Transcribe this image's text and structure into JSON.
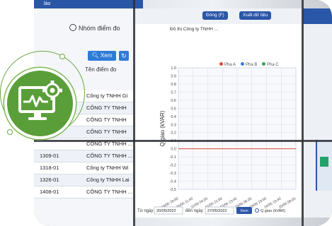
{
  "left_panel": {
    "window_title": "láo",
    "radio_label": "Nhóm điểm đo",
    "search_label": "Xem",
    "refresh_icon": "refresh-icon",
    "column_header": "Tên điểm đo",
    "rows": [
      {
        "code": "",
        "name": "Công ty TNHH Gi"
      },
      {
        "code": "",
        "name": "CÔNG TY TNHH"
      },
      {
        "code": "",
        "name": "CÔNG TY TNHH"
      },
      {
        "code": "",
        "name": "CÔNG TY TNHH"
      },
      {
        "code": "",
        "name": "CÔNG TY TNHH ..."
      },
      {
        "code": "1309-01",
        "name": "CÔNG TY TNHH ..."
      },
      {
        "code": "1318-01",
        "name": "Công ty TNHH Wi"
      },
      {
        "code": "1326-01",
        "name": "Công ty TNHH Lai"
      },
      {
        "code": "1408-01",
        "name": "CÔNG TY TNHH ..."
      }
    ]
  },
  "chart_panel": {
    "toolbar_buttons": [
      "Đóng (F)",
      "Xuất dữ liệu"
    ],
    "title": "Đồ thị Công ty TNHH ...",
    "legend": [
      "Pha A",
      "Pha B",
      "Pha C"
    ],
    "ylabel": "Q giao (kVAR)",
    "footer": {
      "from_label": "Từ ngày",
      "from_value": "20/05/2022",
      "to_label": "đến ngày",
      "to_value": "27/05/2022",
      "view_label": "Xem",
      "option_label": "Q giao (kVAR)"
    }
  },
  "chart_data": {
    "type": "line",
    "ylabel": "Q giao (kVAR)",
    "ylim": [
      -0.5,
      1.0
    ],
    "yticks": [
      "1.0",
      "0.9",
      "0.8",
      "0.7",
      "0.6",
      "0.5",
      "0.4",
      "0.3",
      "0.2",
      "0.1",
      "0.0",
      "-0.1",
      "-0.2",
      "-0.3",
      "-0.4",
      "-0.5"
    ],
    "xticks": [
      "19/05 18:00",
      "20/05 11:40",
      "21/05 04:20",
      "21/05 21:00",
      "22/05 13:40",
      "23/05 06:20",
      "23/05 23:00",
      "24/05 15:40",
      "25/05 08:20"
    ],
    "series": [
      {
        "values": [
          0,
          0,
          0,
          0,
          0,
          0,
          0,
          0,
          0
        ],
        "color": "#e04a3a"
      }
    ],
    "grid": true,
    "legend_position": "top"
  },
  "colors": {
    "brand_blue": "#2a56a8",
    "accent_green": "#5a9e39",
    "line_red": "#e04a3a"
  },
  "badge": {
    "icon": "monitor-gear-icon"
  }
}
